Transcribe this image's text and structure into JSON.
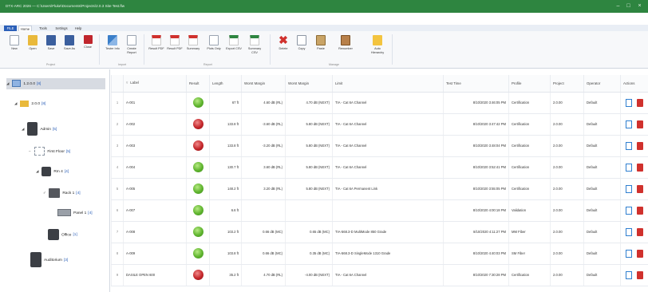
{
  "window": {
    "title": "DTX-ARC 2026 — C:\\Users\\Fluke\\Documents\\Projects\\2.0.3 Site Test.flw"
  },
  "tabs": [
    {
      "label": "FILE"
    },
    {
      "label": "Home"
    },
    {
      "label": "Tools"
    },
    {
      "label": "Settings"
    },
    {
      "label": "Help"
    }
  ],
  "ribbon": {
    "buttons": [
      {
        "label": "New",
        "icon": "new-document-icon"
      },
      {
        "label": "Open",
        "icon": "folder-icon"
      },
      {
        "label": "Save",
        "icon": "save-icon"
      },
      {
        "label": "Save As",
        "icon": "save-as-icon"
      },
      {
        "label": "Close",
        "icon": "close-icon"
      },
      {
        "label": "Tester Info",
        "icon": "tester-icon"
      },
      {
        "label": "Create Report",
        "icon": "report-icon"
      },
      {
        "label": "Result PDF",
        "icon": "pdf-icon"
      },
      {
        "label": "Result PDF",
        "icon": "pdf-icon"
      },
      {
        "label": "Summary",
        "icon": "pdf-icon"
      },
      {
        "label": "Plots Only",
        "icon": "export-icon"
      },
      {
        "label": "Export CSV",
        "icon": "csv-icon"
      },
      {
        "label": "Summary CSV",
        "icon": "csv-icon"
      },
      {
        "label": "Delete",
        "icon": "delete-icon"
      },
      {
        "label": "Copy",
        "icon": "copy-icon"
      },
      {
        "label": "Paste",
        "icon": "paste-icon"
      },
      {
        "label": "Renumber",
        "icon": "renumber-icon"
      },
      {
        "label": "Auto Hierarchy",
        "icon": "hierarchy-icon"
      }
    ],
    "groups": [
      {
        "label": "Project"
      },
      {
        "label": "Import"
      },
      {
        "label": "Report"
      },
      {
        "label": "Manage"
      }
    ]
  },
  "tree": [
    {
      "label": "1.2.0.0",
      "count": "[8]",
      "icon": "project-icon"
    },
    {
      "label": "2.0.0",
      "count": "[8]",
      "icon": "folder-icon"
    },
    {
      "label": "Admin",
      "count": "[5]",
      "icon": "building-icon"
    },
    {
      "label": "First Floor",
      "count": "[5]",
      "icon": "floor-icon"
    },
    {
      "label": "Rm 4",
      "count": "[4]",
      "icon": "room-icon"
    },
    {
      "label": "Rack 1",
      "count": "[4]",
      "icon": "rack-icon"
    },
    {
      "label": "Panel 1",
      "count": "[4]",
      "icon": "panel-icon"
    },
    {
      "label": "Office",
      "count": "[1]",
      "icon": "office-icon"
    },
    {
      "label": "Auditorium",
      "count": "[3]",
      "icon": "building-icon"
    }
  ],
  "table": {
    "columns": [
      "",
      "Label",
      "Result",
      "Length",
      "Worst Margin",
      "Worst Margin",
      "Limit",
      "Test Time",
      "Profile",
      "Project",
      "Operator",
      "Actions"
    ],
    "rows": [
      {
        "n": "1",
        "label": "A-001",
        "result": "pass",
        "length": "67 ft",
        "wm1": "4.60 dB (RL)",
        "wm2": "4.70 dB (NEXT)",
        "limit": "TIA - Cat 6A Channel",
        "time": "8/10/2020 3:46:05 PM",
        "profile": "Certification",
        "project": "2.0.00",
        "operator": "Default"
      },
      {
        "n": "2",
        "label": "A-002",
        "result": "fail",
        "length": "133.8 ft",
        "wm1": "-3.60 dB (RL)",
        "wm2": "5.80 dB (NEXT)",
        "limit": "TIA - Cat 6A Channel",
        "time": "8/10/2020 3:47:42 PM",
        "profile": "Certification",
        "project": "2.0.00",
        "operator": "Default"
      },
      {
        "n": "3",
        "label": "A-003",
        "result": "fail",
        "length": "133.8 ft",
        "wm1": "-3.20 dB (RL)",
        "wm2": "5.80 dB (NEXT)",
        "limit": "TIA - Cat 6A Channel",
        "time": "8/10/2020 3:48:04 PM",
        "profile": "Certification",
        "project": "2.0.00",
        "operator": "Default"
      },
      {
        "n": "4",
        "label": "A-004",
        "result": "pass",
        "length": "130.7 ft",
        "wm1": "3.60 dB (RL)",
        "wm2": "5.80 dB (NEXT)",
        "limit": "TIA - Cat 6A Channel",
        "time": "8/10/2020 3:52:41 PM",
        "profile": "Certification",
        "project": "2.0.00",
        "operator": "Default"
      },
      {
        "n": "5",
        "label": "A-005",
        "result": "pass",
        "length": "148.2 ft",
        "wm1": "3.20 dB (RL)",
        "wm2": "5.80 dB (NEXT)",
        "limit": "TIA - Cat 6A Permanent Link",
        "time": "8/10/2020 3:55:05 PM",
        "profile": "Certification",
        "project": "2.0.00",
        "operator": "Default"
      },
      {
        "n": "6",
        "label": "A-007",
        "result": "pass",
        "length": "6.6 ft",
        "wm1": "",
        "wm2": "",
        "limit": "",
        "time": "8/10/2020 4:00:18 PM",
        "profile": "Validation",
        "project": "2.0.00",
        "operator": "Default"
      },
      {
        "n": "7",
        "label": "A-008",
        "result": "pass",
        "length": "103.2 ft",
        "wm1": "0.66 dB (MC)",
        "wm2": "0.65 dB (MC)",
        "limit": "TIA-568.3-D MultiMode 850 Grade",
        "time": "8/10/2020 4:11:27 PM",
        "profile": "MM Fiber",
        "project": "2.0.00",
        "operator": "Default"
      },
      {
        "n": "8",
        "label": "A-009",
        "result": "pass",
        "length": "103.8 ft",
        "wm1": "0.66 dB (MC)",
        "wm2": "0.35 dB (MC)",
        "limit": "TIA-568.3-D SingleMode 1310 Grade",
        "time": "8/10/2020 4:40:03 PM",
        "profile": "SM Fiber",
        "project": "2.0.00",
        "operator": "Default"
      },
      {
        "n": "9",
        "label": "DASILE OPEN 600",
        "result": "fail",
        "length": "35.2 ft",
        "wm1": "4.70 dB (RL)",
        "wm2": "-4.00 dB (NEXT)",
        "limit": "TIA - Cat 6A Channel",
        "time": "8/10/2020 7:30:28 PM",
        "profile": "Certification",
        "project": "2.0.00",
        "operator": "Default"
      }
    ]
  },
  "colors": {
    "titlebar": "#2e8540",
    "file_tab": "#2b5fb8",
    "pass": "#5fb42e",
    "fail": "#c4262a",
    "selection": "#d7dbe2"
  }
}
